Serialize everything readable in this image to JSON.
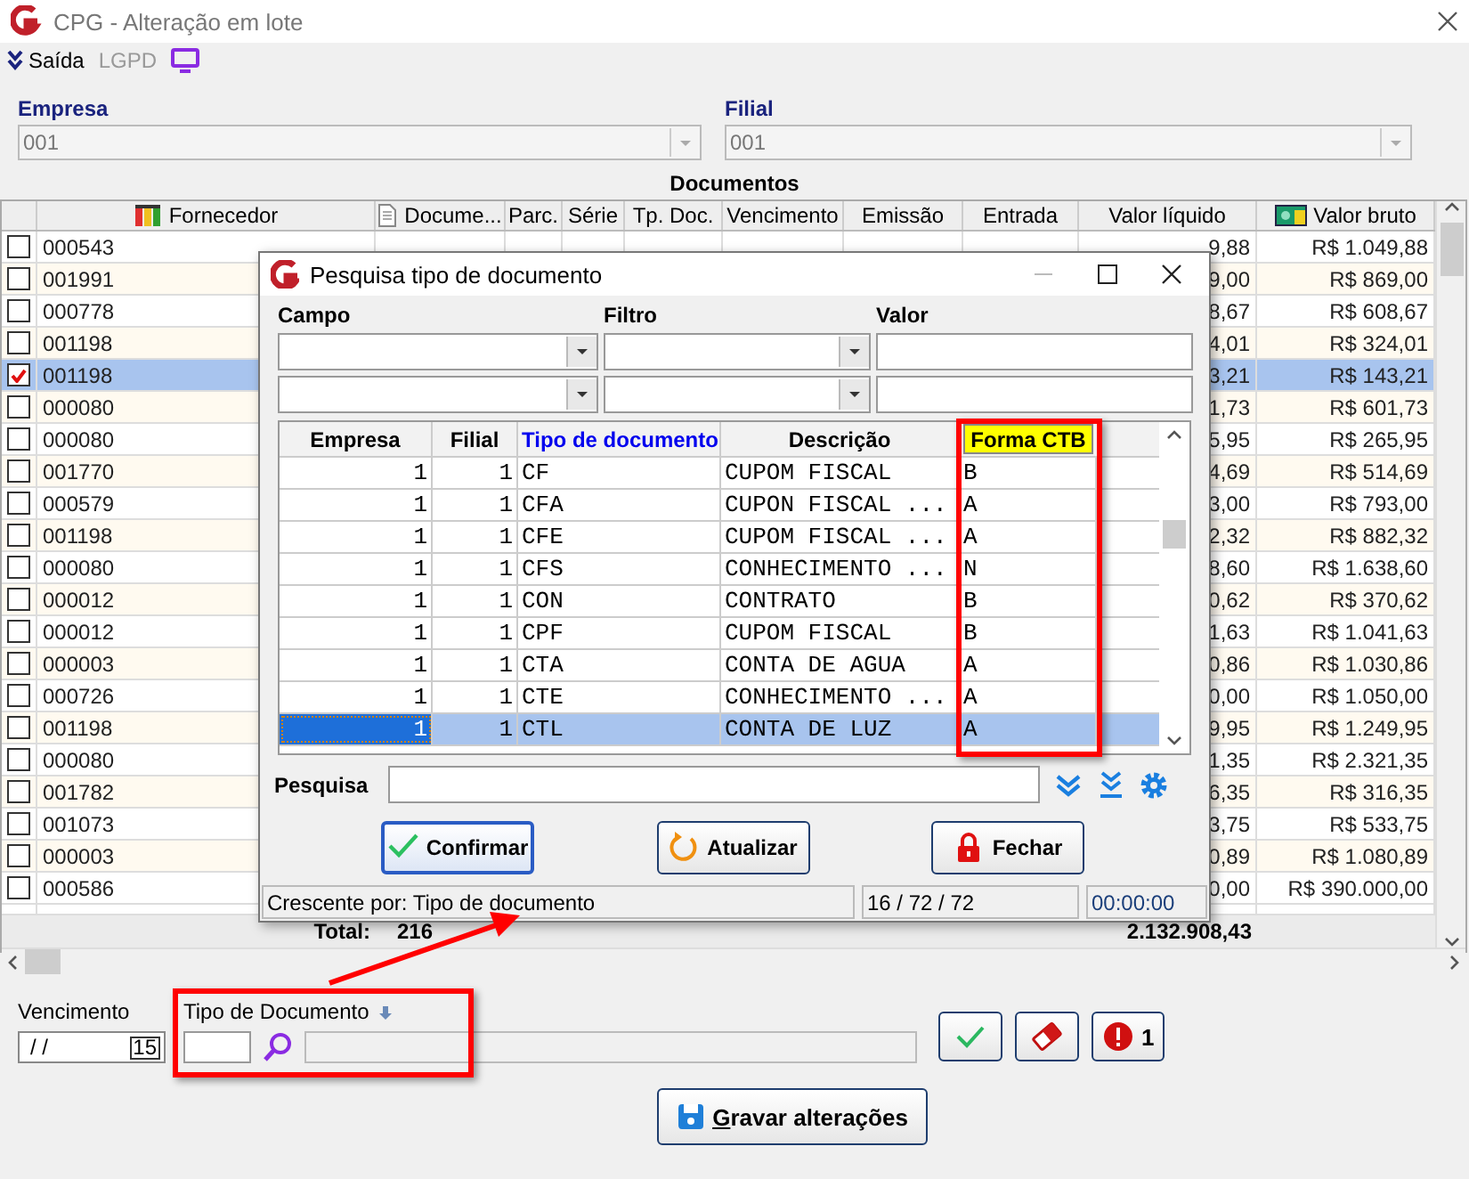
{
  "window": {
    "title": "CPG - Alteração em lote"
  },
  "toolbar": [
    {
      "label": "Saída",
      "disabled": false
    },
    {
      "label": "LGPD",
      "disabled": true
    }
  ],
  "empresa": {
    "label": "Empresa",
    "value": "001"
  },
  "filial": {
    "label": "Filial",
    "value": "001"
  },
  "documents": {
    "title": "Documentos",
    "columns": [
      "Fornecedor",
      "Docume...",
      "Parc.",
      "Série",
      "Tp. Doc.",
      "Vencimento",
      "Emissão",
      "Entrada",
      "Valor líquido",
      "Valor bruto"
    ],
    "rows": [
      {
        "checked": false,
        "selected": false,
        "code": "000543",
        "valor_liquido": "9,88",
        "valor_bruto": "R$ 1.049,88"
      },
      {
        "checked": false,
        "selected": false,
        "code": "001991",
        "valor_liquido": "9,00",
        "valor_bruto": "R$ 869,00"
      },
      {
        "checked": false,
        "selected": false,
        "code": "000778",
        "valor_liquido": "8,67",
        "valor_bruto": "R$ 608,67"
      },
      {
        "checked": false,
        "selected": false,
        "code": "001198",
        "valor_liquido": "4,01",
        "valor_bruto": "R$ 324,01"
      },
      {
        "checked": true,
        "selected": true,
        "code": "001198",
        "valor_liquido": "3,21",
        "valor_bruto": "R$ 143,21"
      },
      {
        "checked": false,
        "selected": false,
        "code": "000080",
        "valor_liquido": "1,73",
        "valor_bruto": "R$ 601,73"
      },
      {
        "checked": false,
        "selected": false,
        "code": "000080",
        "valor_liquido": "5,95",
        "valor_bruto": "R$ 265,95"
      },
      {
        "checked": false,
        "selected": false,
        "code": "001770",
        "valor_liquido": "4,69",
        "valor_bruto": "R$ 514,69"
      },
      {
        "checked": false,
        "selected": false,
        "code": "000579",
        "valor_liquido": "3,00",
        "valor_bruto": "R$ 793,00"
      },
      {
        "checked": false,
        "selected": false,
        "code": "001198",
        "valor_liquido": "2,32",
        "valor_bruto": "R$ 882,32"
      },
      {
        "checked": false,
        "selected": false,
        "code": "000080",
        "valor_liquido": "8,60",
        "valor_bruto": "R$ 1.638,60"
      },
      {
        "checked": false,
        "selected": false,
        "code": "000012",
        "valor_liquido": "0,62",
        "valor_bruto": "R$ 370,62"
      },
      {
        "checked": false,
        "selected": false,
        "code": "000012",
        "valor_liquido": "1,63",
        "valor_bruto": "R$ 1.041,63"
      },
      {
        "checked": false,
        "selected": false,
        "code": "000003",
        "valor_liquido": "0,86",
        "valor_bruto": "R$ 1.030,86"
      },
      {
        "checked": false,
        "selected": false,
        "code": "000726",
        "valor_liquido": "0,00",
        "valor_bruto": "R$ 1.050,00"
      },
      {
        "checked": false,
        "selected": false,
        "code": "001198",
        "valor_liquido": "9,95",
        "valor_bruto": "R$ 1.249,95"
      },
      {
        "checked": false,
        "selected": false,
        "code": "000080",
        "valor_liquido": "1,35",
        "valor_bruto": "R$ 2.321,35"
      },
      {
        "checked": false,
        "selected": false,
        "code": "001782",
        "valor_liquido": "6,35",
        "valor_bruto": "R$ 316,35"
      },
      {
        "checked": false,
        "selected": false,
        "code": "001073",
        "valor_liquido": "3,75",
        "valor_bruto": "R$ 533,75"
      },
      {
        "checked": false,
        "selected": false,
        "code": "000003",
        "valor_liquido": "0,89",
        "valor_bruto": "R$ 1.080,89"
      },
      {
        "checked": false,
        "selected": false,
        "code": "000586",
        "valor_liquido": "0,00",
        "valor_bruto": "R$ 390.000,00"
      }
    ],
    "footer": {
      "label": "Total:",
      "count": "216",
      "total": "2.132.908,43"
    }
  },
  "dialog": {
    "title": "Pesquisa tipo de documento",
    "filter_labels": [
      "Campo",
      "Filtro",
      "Valor"
    ],
    "columns": [
      {
        "label": "Empresa",
        "sorted": false,
        "highlighted": false
      },
      {
        "label": "Filial",
        "sorted": false,
        "highlighted": false
      },
      {
        "label": "Tipo de documento",
        "sorted": true,
        "highlighted": false
      },
      {
        "label": "Descrição",
        "sorted": false,
        "highlighted": false
      },
      {
        "label": "Forma CTB",
        "sorted": false,
        "highlighted": true
      }
    ],
    "rows": [
      {
        "selected": false,
        "cells": [
          "1",
          "1",
          "CF",
          "CUPOM FISCAL",
          "B"
        ]
      },
      {
        "selected": false,
        "cells": [
          "1",
          "1",
          "CFA",
          "CUPON FISCAL ...",
          "A"
        ]
      },
      {
        "selected": false,
        "cells": [
          "1",
          "1",
          "CFE",
          "CUPOM FISCAL ...",
          "A"
        ]
      },
      {
        "selected": false,
        "cells": [
          "1",
          "1",
          "CFS",
          "CONHECIMENTO ...",
          "N"
        ]
      },
      {
        "selected": false,
        "cells": [
          "1",
          "1",
          "CON",
          "CONTRATO",
          "B"
        ]
      },
      {
        "selected": false,
        "cells": [
          "1",
          "1",
          "CPF",
          "CUPOM FISCAL",
          "B"
        ]
      },
      {
        "selected": false,
        "cells": [
          "1",
          "1",
          "CTA",
          "CONTA DE AGUA",
          "A"
        ]
      },
      {
        "selected": false,
        "cells": [
          "1",
          "1",
          "CTE",
          "CONHECIMENTO ...",
          "A"
        ]
      },
      {
        "selected": true,
        "cells": [
          "1",
          "1",
          "CTL",
          "CONTA DE LUZ",
          "A"
        ]
      }
    ],
    "search_label": "Pesquisa",
    "buttons": [
      {
        "label": "Confirmar",
        "kind": "confirm",
        "focused": true
      },
      {
        "label": "Atualizar",
        "kind": "refresh",
        "focused": false
      },
      {
        "label": "Fechar",
        "kind": "close",
        "focused": false
      }
    ],
    "status": {
      "sort": "Crescente por: Tipo de documento",
      "count": "16 / 72 / 72",
      "time": "00:00:00"
    }
  },
  "bottom": {
    "vencimento_label": "Vencimento",
    "vencimento_value": "/ /",
    "calendar_day": "15",
    "tipo_label": "Tipo de Documento",
    "alert_count": "1",
    "save_label": "Gravar alterações"
  }
}
